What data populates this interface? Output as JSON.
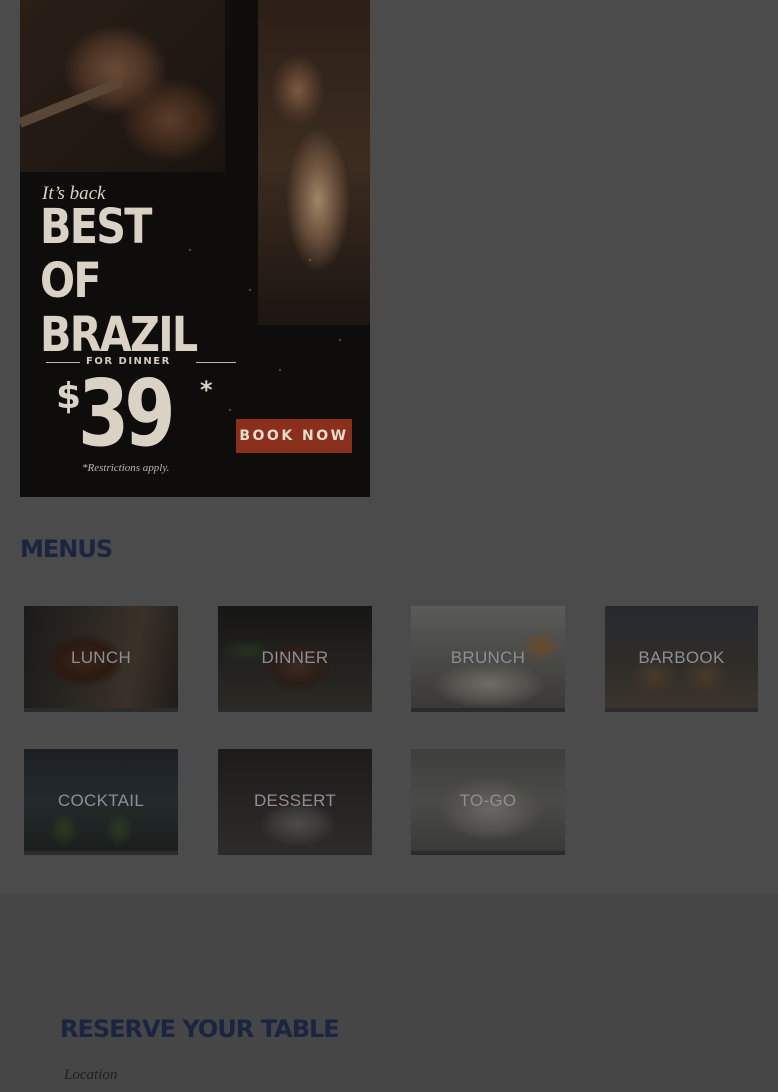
{
  "promo": {
    "tagline": "It’s back",
    "headline_line1": "BEST",
    "headline_line2": "OF",
    "headline_line3": "BRAZIL",
    "subhead": "FOR DINNER",
    "price_currency": "$",
    "price_amount": "39",
    "price_asterisk": "*",
    "cta_label": "BOOK NOW",
    "restrictions": "*Restrictions apply."
  },
  "menus": {
    "heading": "MENUS",
    "items": [
      {
        "label": "LUNCH"
      },
      {
        "label": "DINNER"
      },
      {
        "label": "BRUNCH"
      },
      {
        "label": "BARBOOK"
      },
      {
        "label": "COCKTAIL"
      },
      {
        "label": "DESSERT"
      },
      {
        "label": "TO-GO"
      }
    ]
  },
  "reserve": {
    "heading": "RESERVE YOUR TABLE",
    "location_label": "Location"
  },
  "colors": {
    "overlay_dim": "#4b4b4b",
    "heading_navy": "#1b2440",
    "cta_red": "#8a2f1b",
    "tile_label_gray": "#8e8e94"
  }
}
